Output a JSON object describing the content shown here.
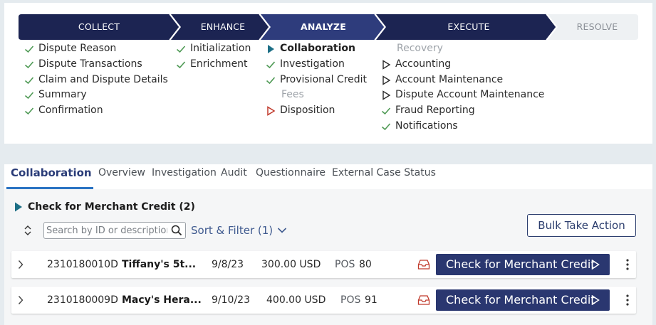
{
  "stages": [
    {
      "label": "COLLECT",
      "state": "done"
    },
    {
      "label": "ENHANCE",
      "state": "done"
    },
    {
      "label": "ANALYZE",
      "state": "current"
    },
    {
      "label": "EXECUTE",
      "state": "done"
    },
    {
      "label": "RESOLVE",
      "state": "future"
    }
  ],
  "steps": {
    "collect": [
      "Dispute Reason",
      "Dispute Transactions",
      "Claim and Dispute Details",
      "Summary",
      "Confirmation"
    ],
    "enhance": [
      "Initialization",
      "Enrichment"
    ],
    "analyze": [
      "Collaboration",
      "Investigation",
      "Provisional Credit",
      "Fees",
      "Disposition"
    ],
    "execute": [
      "Recovery",
      "Accounting",
      "Account Maintenance",
      "Dispute Account Maintenance",
      "Fraud Reporting",
      "Notifications"
    ]
  },
  "tabs": [
    "Collaboration",
    "Overview",
    "Investigation",
    "Audit",
    "Questionnaire",
    "External Case Status"
  ],
  "section": {
    "title": "Check for Merchant Credit (2)"
  },
  "search": {
    "placeholder": "Search by ID or description"
  },
  "sort_filter": {
    "label": "Sort & Filter (1)"
  },
  "bulk": {
    "label": "Bulk Take Action"
  },
  "rows": [
    {
      "id": "2310180010D",
      "name": "Tiffany's 5t...",
      "date": "9/8/23",
      "amount": "300.00 USD",
      "type": "POS",
      "code": "80",
      "action": "Check for Merchant Credit"
    },
    {
      "id": "2310180009D",
      "name": "Macy's Hera...",
      "date": "9/10/23",
      "amount": "400.00 USD",
      "type": "POS",
      "code": "91",
      "action": "Check for Merchant Credit"
    }
  ],
  "colors": {
    "stage_done": "#1c2452",
    "stage_current": "#2e3c7c",
    "stage_future": "#eef1f3",
    "check": "#4f9a55",
    "current_marker": "#1d6f86",
    "alert_marker": "#c0392b",
    "primary_button": "#2a3770"
  }
}
